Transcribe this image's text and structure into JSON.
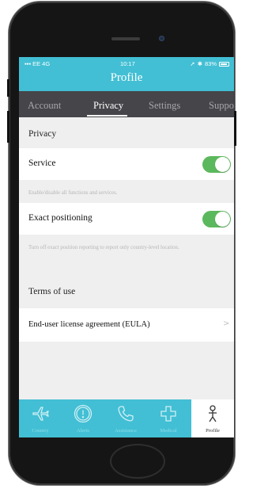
{
  "status": {
    "carrier": "EE 4G",
    "time": "10:17",
    "battery": "83%"
  },
  "header": {
    "title": "Profile"
  },
  "tabs": [
    {
      "label": "Account"
    },
    {
      "label": "Privacy"
    },
    {
      "label": "Settings"
    },
    {
      "label": "Suppo"
    }
  ],
  "privacy": {
    "section_title": "Privacy",
    "service": {
      "label": "Service",
      "help": "Enable/disable all functions and services.",
      "enabled": true
    },
    "exact_positioning": {
      "label": "Exact positioning",
      "help": "Turn off exact position reporting to report only country-level location.",
      "enabled": true
    }
  },
  "terms": {
    "section_title": "Terms of use",
    "eula_label": "End-user license agreement (EULA)"
  },
  "tabbar": [
    {
      "label": "Country",
      "icon": "plane-icon"
    },
    {
      "label": "Alerts",
      "icon": "alert-icon"
    },
    {
      "label": "Assistance",
      "icon": "phone-icon"
    },
    {
      "label": "Medical",
      "icon": "medical-cross-icon"
    },
    {
      "label": "Profile",
      "icon": "person-icon"
    }
  ],
  "colors": {
    "accent": "#42bfd4",
    "toggle_on": "#5cb85c",
    "tab_bg": "#46454a"
  }
}
